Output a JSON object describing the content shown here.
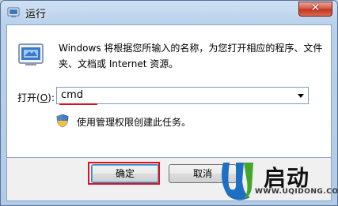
{
  "window": {
    "title": "运行"
  },
  "description": "Windows 将根据您所输入的名称，为您打开相应的程序、文件夹、文档或 Internet 资源。",
  "open_field": {
    "label_prefix": "打开(",
    "label_accel": "O",
    "label_suffix": "):",
    "value": "cmd"
  },
  "admin_note": "使用管理权限创建此任务。",
  "buttons": {
    "ok": "确定",
    "cancel": "取消"
  },
  "watermark": {
    "brand_cn": "启动",
    "url": "WWW.UQIDONG.COM"
  },
  "colors": {
    "highlight_red": "#d4121d",
    "brand_blue": "#1e6fc1",
    "brand_green": "#43a62a"
  }
}
